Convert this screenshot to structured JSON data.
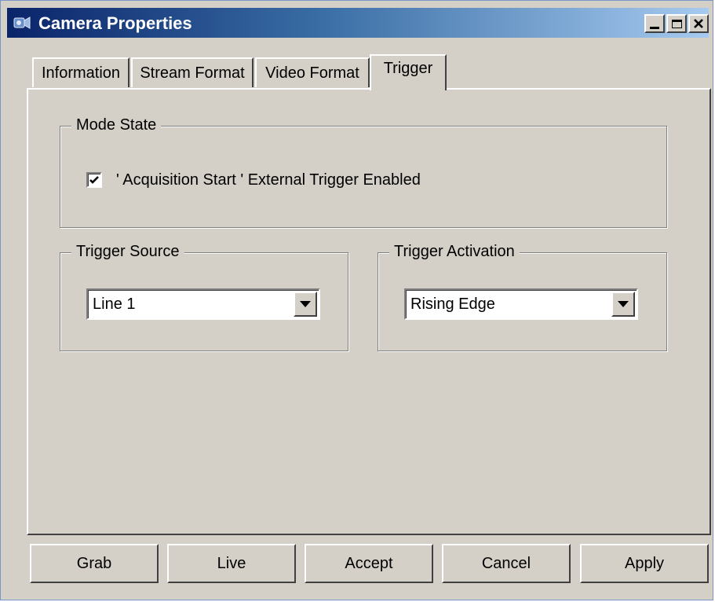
{
  "window": {
    "title": "Camera Properties",
    "title_bar_color": "#0a246a",
    "app_icon": "camera-icon"
  },
  "tabs": [
    {
      "label": "Information",
      "active": false
    },
    {
      "label": "Stream Format",
      "active": false
    },
    {
      "label": "Video Format",
      "active": false
    },
    {
      "label": "Trigger",
      "active": true
    }
  ],
  "mode_state": {
    "group_label": "Mode State",
    "checkbox_label": "' Acquisition Start ' External Trigger Enabled",
    "checked": true
  },
  "trigger_source": {
    "group_label": "Trigger Source",
    "selected": "Line 1"
  },
  "trigger_activation": {
    "group_label": "Trigger Activation",
    "selected": "Rising Edge"
  },
  "buttons": {
    "grab": "Grab",
    "live": "Live",
    "accept": "Accept",
    "cancel": "Cancel",
    "apply": "Apply"
  },
  "colors": {
    "face": "#d4d0c8"
  }
}
